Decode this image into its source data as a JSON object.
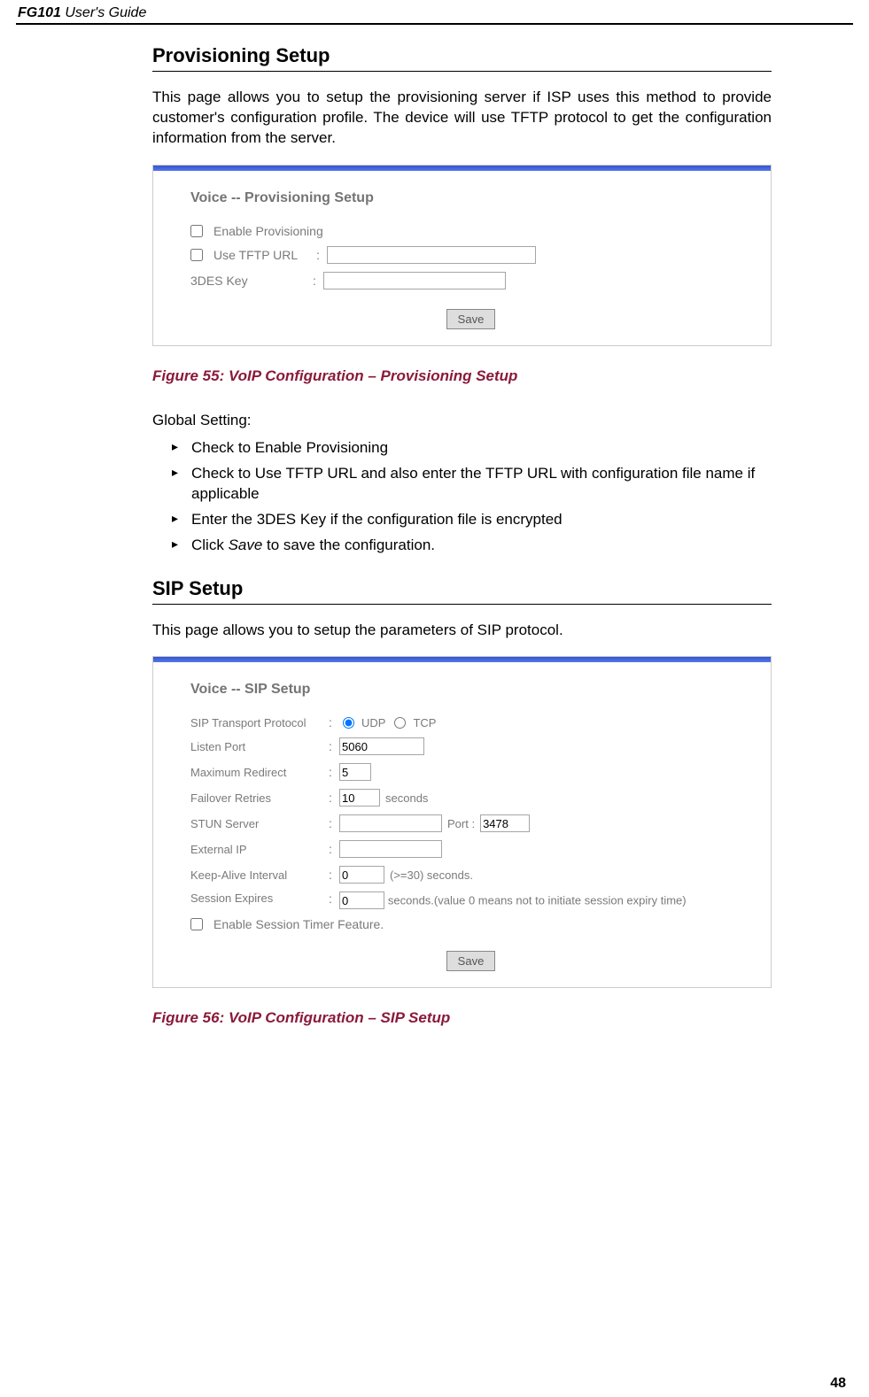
{
  "header": {
    "doc_title": "FG101 User's Guide"
  },
  "section1": {
    "title": "Provisioning Setup",
    "intro": "This page allows you to setup the provisioning server if ISP uses this method to provide customer's configuration profile. The device will use TFTP protocol to get the configuration information from the server.",
    "screenshot": {
      "panel_title": "Voice -- Provisioning Setup",
      "enable_label": "Enable Provisioning",
      "tftp_label": "Use TFTP URL",
      "tftp_value": "",
      "des_label": "3DES Key",
      "des_value": "",
      "save_label": "Save"
    },
    "caption": "Figure 55: VoIP Configuration – Provisioning Setup",
    "subheading": "Global Setting:",
    "bullets": [
      "Check to Enable Provisioning",
      "Check to Use TFTP URL and also enter the TFTP URL with configuration file name if applicable",
      "Enter the 3DES Key if the configuration file is encrypted",
      "Click Save to save the configuration."
    ],
    "bullet4_prefix": "Click ",
    "bullet4_italic": "Save",
    "bullet4_suffix": " to save the configuration."
  },
  "section2": {
    "title": "SIP Setup",
    "intro": "This page allows you to setup the parameters of SIP protocol.",
    "screenshot": {
      "panel_title": "Voice -- SIP Setup",
      "transport_label": "SIP Transport Protocol",
      "udp_label": "UDP",
      "tcp_label": "TCP",
      "listen_label": "Listen Port",
      "listen_value": "5060",
      "maxred_label": "Maximum Redirect",
      "maxred_value": "5",
      "failover_label": "Failover Retries",
      "failover_value": "10",
      "failover_unit": "seconds",
      "stun_label": "STUN Server",
      "stun_value": "",
      "port_label": "Port :",
      "port_value": "3478",
      "extip_label": "External IP",
      "extip_value": "",
      "keepalive_label": "Keep-Alive Interval",
      "keepalive_value": "0",
      "keepalive_unit": "(>=30) seconds.",
      "sessexp_label": "Session Expires",
      "sessexp_value": "0",
      "sessexp_unit": "seconds.(value 0 means not to initiate session expiry time)",
      "enable_sess_label": "Enable Session Timer Feature.",
      "save_label": "Save"
    },
    "caption": "Figure 56: VoIP Configuration – SIP Setup"
  },
  "page_number": "48"
}
